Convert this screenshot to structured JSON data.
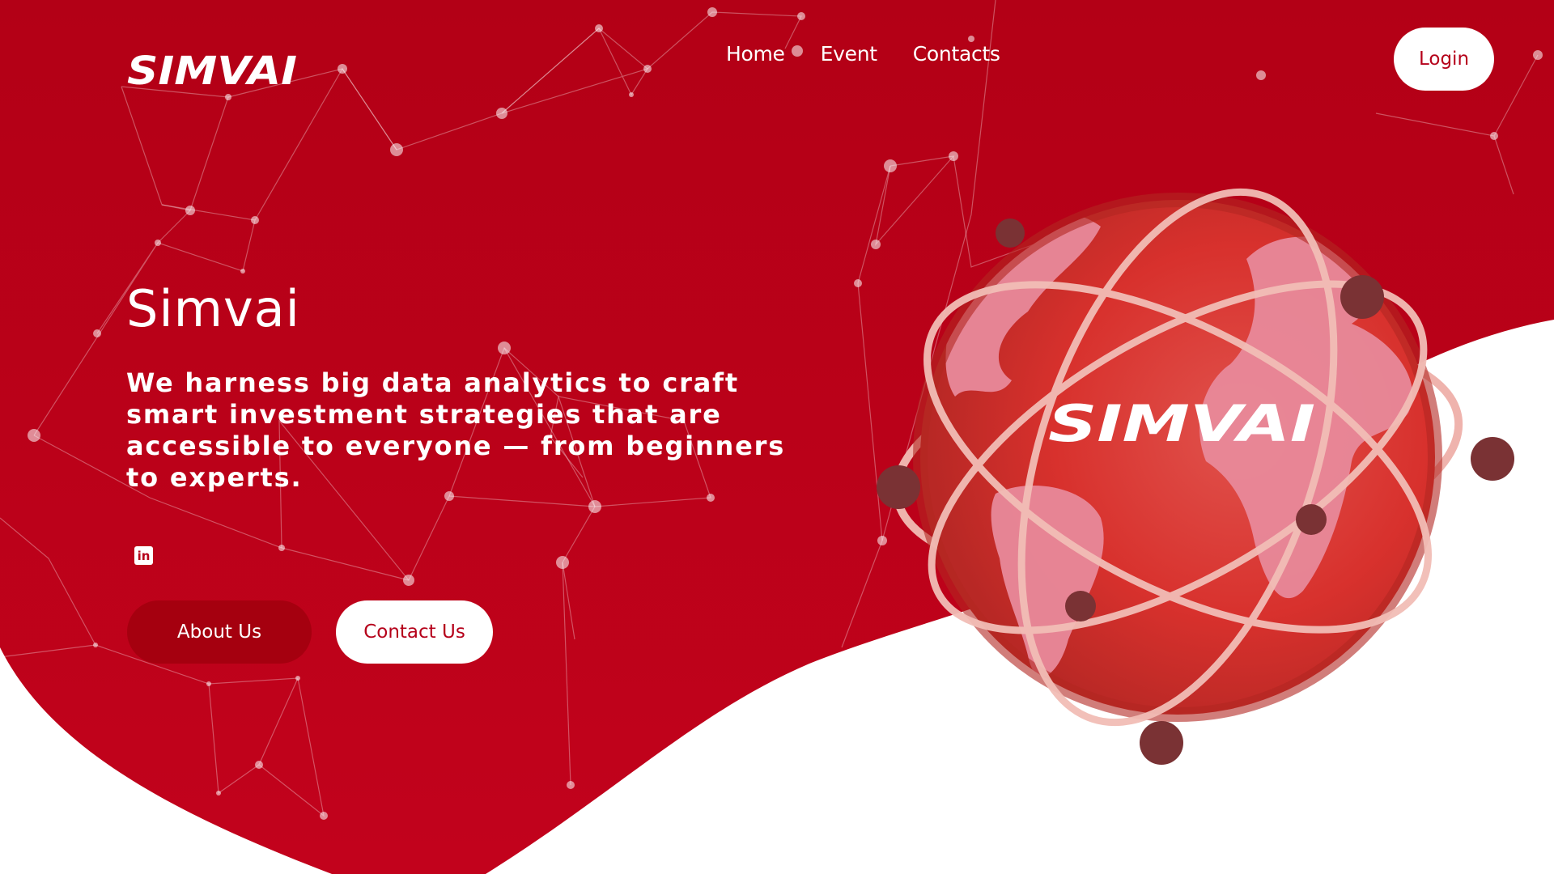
{
  "brand": {
    "logo_text": "SIMVAI"
  },
  "nav": {
    "items": [
      {
        "label": "Home"
      },
      {
        "label": "Event"
      },
      {
        "label": "Contacts"
      }
    ]
  },
  "header": {
    "login_label": "Login"
  },
  "hero": {
    "title": "Simvai",
    "description": "We harness big data analytics to craft smart investment strategies that are accessible to everyone — from beginners to experts.",
    "social": {
      "linkedin_glyph": "in"
    },
    "about_label": "About Us",
    "contact_label": "Contact Us"
  },
  "illustration": {
    "globe_logo_text": "SIMVAI"
  },
  "colors": {
    "brand_red": "#b5001a",
    "dark_red": "#a5000f",
    "white": "#ffffff"
  },
  "icons": [
    "linkedin-icon"
  ]
}
